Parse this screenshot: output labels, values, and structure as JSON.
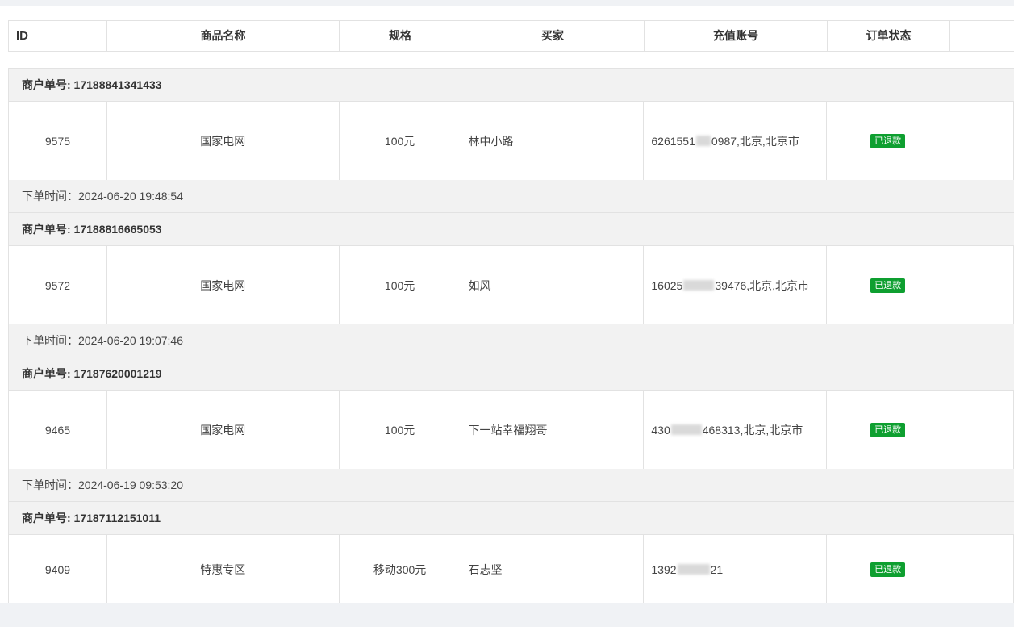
{
  "table": {
    "headers": {
      "id": "ID",
      "name": "商品名称",
      "spec": "规格",
      "buyer": "买家",
      "account": "充值账号",
      "status": "订单状态",
      "op": ""
    }
  },
  "labels": {
    "merchant_prefix": "商户单号: ",
    "time_prefix": "下单时间：",
    "badge_color": "#0e9f30"
  },
  "orders": [
    {
      "merchant_no": "商户单号: 17188841341433",
      "id": "9575",
      "name": "国家电网",
      "spec": "100元",
      "buyer": "林中小路",
      "account_start": "6261551",
      "account_end": "0987,北京,北京市",
      "status": "已退款",
      "time": "下单时间：2024-06-20 19:48:54"
    },
    {
      "merchant_no": "商户单号: 17188816665053",
      "id": "9572",
      "name": "国家电网",
      "spec": "100元",
      "buyer": "如风",
      "account_start": "16025",
      "account_end": "39476,北京,北京市",
      "status": "已退款",
      "time": "下单时间：2024-06-20 19:07:46"
    },
    {
      "merchant_no": "商户单号: 17187620001219",
      "id": "9465",
      "name": "国家电网",
      "spec": "100元",
      "buyer": "下一站幸福翔哥",
      "account_start": "430",
      "account_end": "468313,北京,北京市",
      "status": "已退款",
      "time": "下单时间：2024-06-19 09:53:20"
    },
    {
      "merchant_no": "商户单号: 17187112151011",
      "id": "9409",
      "name": "特惠专区",
      "spec": "移动300元",
      "buyer": "石志坚",
      "account_start": "1392",
      "account_end": "21",
      "status": "已退款",
      "time": ""
    }
  ]
}
